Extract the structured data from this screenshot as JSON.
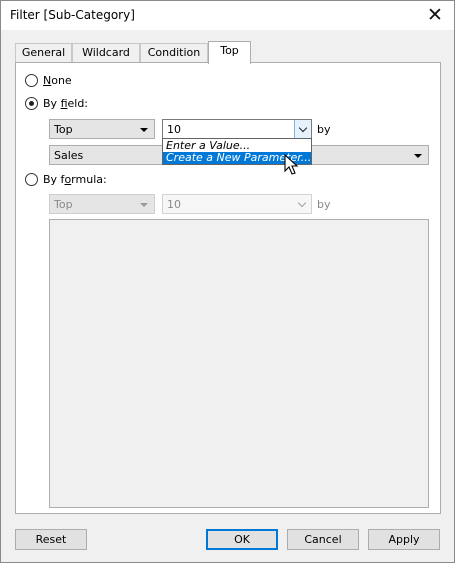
{
  "window": {
    "title": "Filter [Sub-Category]",
    "close_glyph": "✕"
  },
  "tabs": [
    {
      "label": "General",
      "active": false
    },
    {
      "label": "Wildcard",
      "active": false
    },
    {
      "label": "Condition",
      "active": false
    },
    {
      "label": "Top",
      "active": true
    }
  ],
  "options": {
    "none": {
      "label_key": "N",
      "label_rest": "one",
      "selected": false
    },
    "by_field": {
      "label_pre": "By ",
      "label_key": "f",
      "label_post": "ield:",
      "selected": true
    },
    "by_formula": {
      "label_pre": "By f",
      "label_key": "o",
      "label_post": "rmula:",
      "selected": false
    }
  },
  "by_field": {
    "direction": "Top",
    "count_value": "10",
    "by_label": "by",
    "field": "Sales",
    "dropdown_items": [
      {
        "label": "Enter a Value...",
        "highlighted": false
      },
      {
        "label": "Create a New Parameter...",
        "highlighted": true
      }
    ]
  },
  "by_formula": {
    "direction": "Top",
    "count_value": "10",
    "by_label": "by"
  },
  "buttons": {
    "reset": "Reset",
    "ok": "OK",
    "cancel": "Cancel",
    "apply": "Apply"
  },
  "colors": {
    "accent": "#0078d7",
    "highlight_text": "#ffffff"
  }
}
